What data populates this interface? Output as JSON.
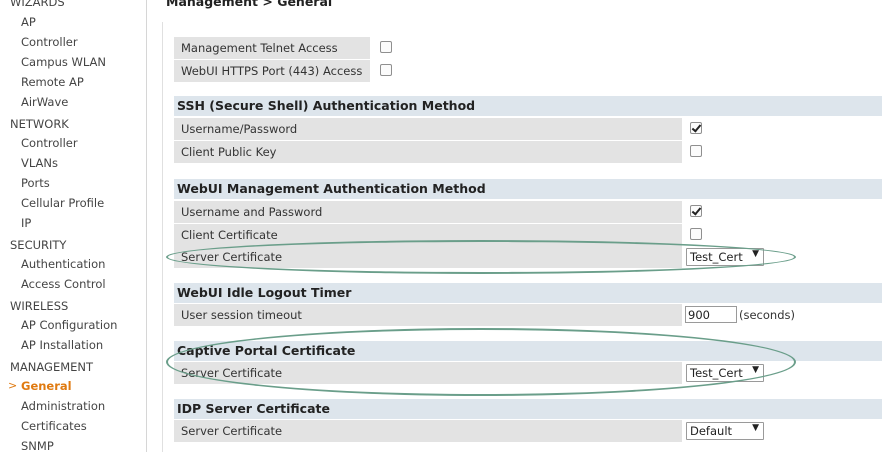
{
  "breadcrumb": "Management > General",
  "sidebar": {
    "sections": [
      {
        "label": "WIZARDS",
        "items": [
          "AP",
          "Controller",
          "Campus WLAN",
          "Remote AP",
          "AirWave"
        ]
      },
      {
        "label": "NETWORK",
        "items": [
          "Controller",
          "VLANs",
          "Ports",
          "Cellular Profile",
          "IP"
        ]
      },
      {
        "label": "SECURITY",
        "items": [
          "Authentication",
          "Access Control"
        ]
      },
      {
        "label": "WIRELESS",
        "items": [
          "AP Configuration",
          "AP Installation"
        ]
      },
      {
        "label": "MANAGEMENT",
        "items": [
          "General",
          "Administration",
          "Certificates",
          "SNMP"
        ]
      }
    ],
    "active_item": "General",
    "active_marker": ">"
  },
  "top_rows": [
    {
      "label": "Management Telnet Access",
      "checked": false
    },
    {
      "label": "WebUI HTTPS Port (443) Access",
      "checked": false
    }
  ],
  "ssh": {
    "title": "SSH (Secure Shell) Authentication Method",
    "rows": [
      {
        "label": "Username/Password",
        "checked": true
      },
      {
        "label": "Client Public Key",
        "checked": false
      }
    ]
  },
  "webui_auth": {
    "title": "WebUI Management Authentication Method",
    "rows": [
      {
        "label": "Username and Password",
        "checked": true
      },
      {
        "label": "Client Certificate",
        "checked": false
      }
    ],
    "server_cert_label": "Server Certificate",
    "server_cert_value": "Test_Cert"
  },
  "idle": {
    "title": "WebUI Idle Logout Timer",
    "label": "User session timeout",
    "value": "900",
    "unit": "(seconds)"
  },
  "captive": {
    "title": "Captive Portal Certificate",
    "label": "Server Certificate",
    "value": "Test_Cert"
  },
  "idp": {
    "title": "IDP Server Certificate",
    "label": "Server Certificate",
    "value": "Default"
  },
  "dropdown_arrow": "▼",
  "colors": {
    "accent": "#e07a10",
    "header_bg": "#dde5ec",
    "row_bg": "#e3e3e3",
    "highlight_ellipse": "#6a9e8a"
  }
}
